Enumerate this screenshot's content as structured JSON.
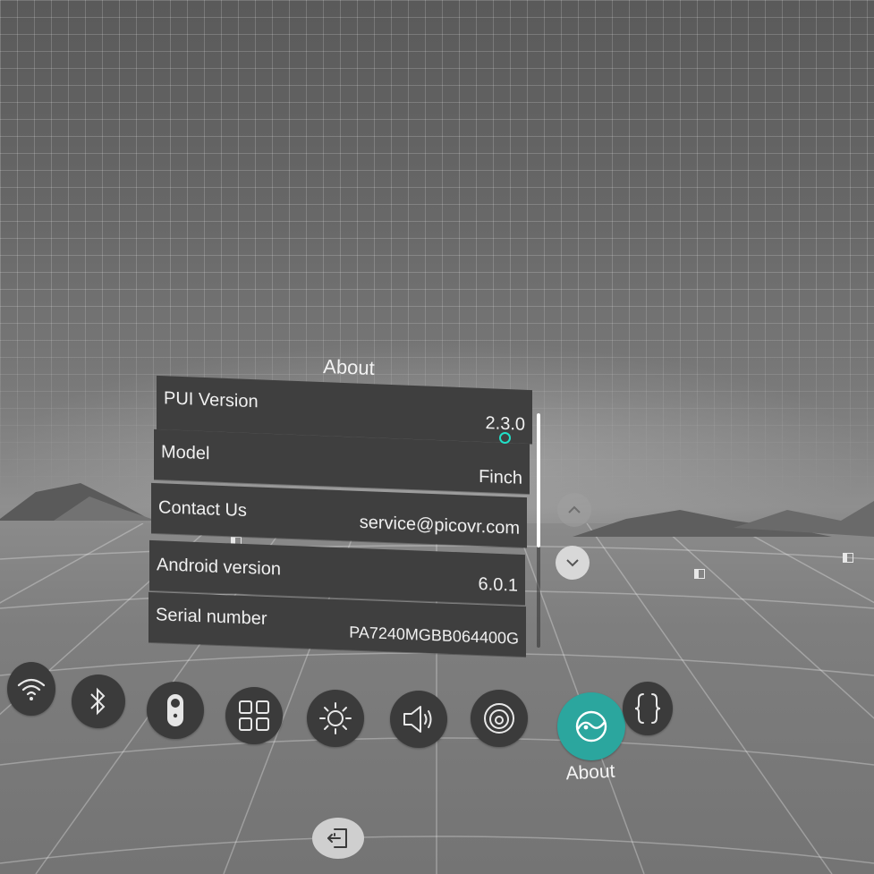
{
  "about_panel": {
    "title": "About",
    "rows": [
      {
        "label": "PUI Version",
        "value": "2.3.0"
      },
      {
        "label": "Model",
        "value": "Finch"
      },
      {
        "label": "Contact Us",
        "value": "service@picovr.com"
      },
      {
        "label": "Android version",
        "value": "6.0.1"
      },
      {
        "label": "Serial number",
        "value": "PA7240MGBB064400G"
      }
    ]
  },
  "dock": {
    "items": [
      {
        "icon": "wifi-icon"
      },
      {
        "icon": "bluetooth-icon"
      },
      {
        "icon": "controller-icon"
      },
      {
        "icon": "apps-grid-icon"
      },
      {
        "icon": "brightness-icon"
      },
      {
        "icon": "volume-icon"
      },
      {
        "icon": "display-icon"
      },
      {
        "icon": "about-icon",
        "label": "About",
        "selected": true
      },
      {
        "icon": "developer-braces-icon"
      }
    ],
    "exit_icon": "exit-icon"
  },
  "colors": {
    "accent": "#2ba69e",
    "cursor": "#21e0c8",
    "row_bg": "#3f3f3f",
    "dock_bg": "#3b3b3b"
  }
}
